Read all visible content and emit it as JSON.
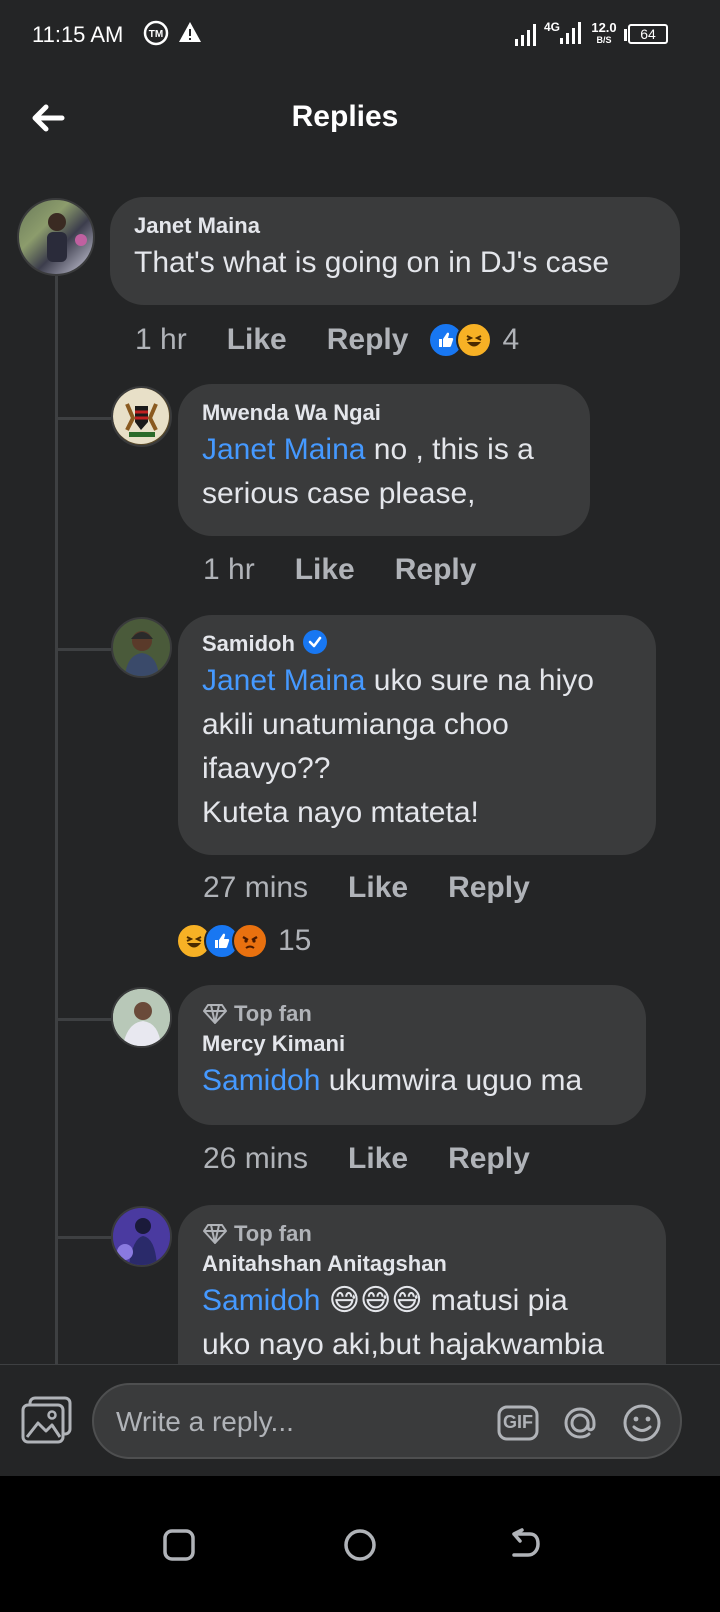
{
  "status_bar": {
    "time": "11:15 AM",
    "network": "4G",
    "speed_value": "12.0",
    "speed_unit": "B/S",
    "battery": "64",
    "icons": [
      "tm-icon",
      "warning-icon",
      "signal-icon",
      "signal-4g-icon",
      "battery-icon"
    ]
  },
  "header": {
    "title": "Replies",
    "back_icon": "back-arrow-icon"
  },
  "comments": [
    {
      "author": "Janet Maina",
      "text": "That's what is going on in DJ's case",
      "time": "1 hr",
      "like_label": "Like",
      "reply_label": "Reply",
      "reactions": [
        "like",
        "haha"
      ],
      "reaction_count": "4"
    },
    {
      "author": "Mwenda Wa Ngai",
      "mention": "Janet Maina",
      "text_line1": " no , this is a",
      "text_line2": "serious case please,",
      "time": "1 hr",
      "like_label": "Like",
      "reply_label": "Reply"
    },
    {
      "author": "Samidoh",
      "verified": true,
      "mention": "Janet Maina",
      "text_line1": " uko sure na hiyo",
      "text_line2": "akili unatumianga choo",
      "text_line3": "ifaavyo??",
      "text_line4": "Kuteta nayo mtateta!",
      "time": "27 mins",
      "like_label": "Like",
      "reply_label": "Reply",
      "reactions": [
        "haha",
        "like",
        "angry"
      ],
      "reaction_count": "15"
    },
    {
      "badge": "Top fan",
      "author": "Mercy Kimani",
      "mention": "Samidoh",
      "text_line1": " ukumwira uguo ma",
      "time": "26 mins",
      "like_label": "Like",
      "reply_label": "Reply"
    },
    {
      "badge": "Top fan",
      "author": "Anitahshan Anitagshan",
      "mention": "Samidoh",
      "emoji": "😅😅😅",
      "text_line1": " matusi pia",
      "text_line2": "uko nayo aki,but hajakwambia"
    }
  ],
  "composer": {
    "placeholder": "Write a reply...",
    "gif_label": "GIF",
    "icons": [
      "photo-icon",
      "gif-icon",
      "mention-icon",
      "emoji-icon"
    ]
  },
  "nav": {
    "icons": [
      "recents-icon",
      "home-icon",
      "back-icon"
    ]
  },
  "colors": {
    "background": "#242526",
    "bubble": "#3a3b3c",
    "mention": "#4599ff",
    "like_blue": "#1877f2"
  }
}
